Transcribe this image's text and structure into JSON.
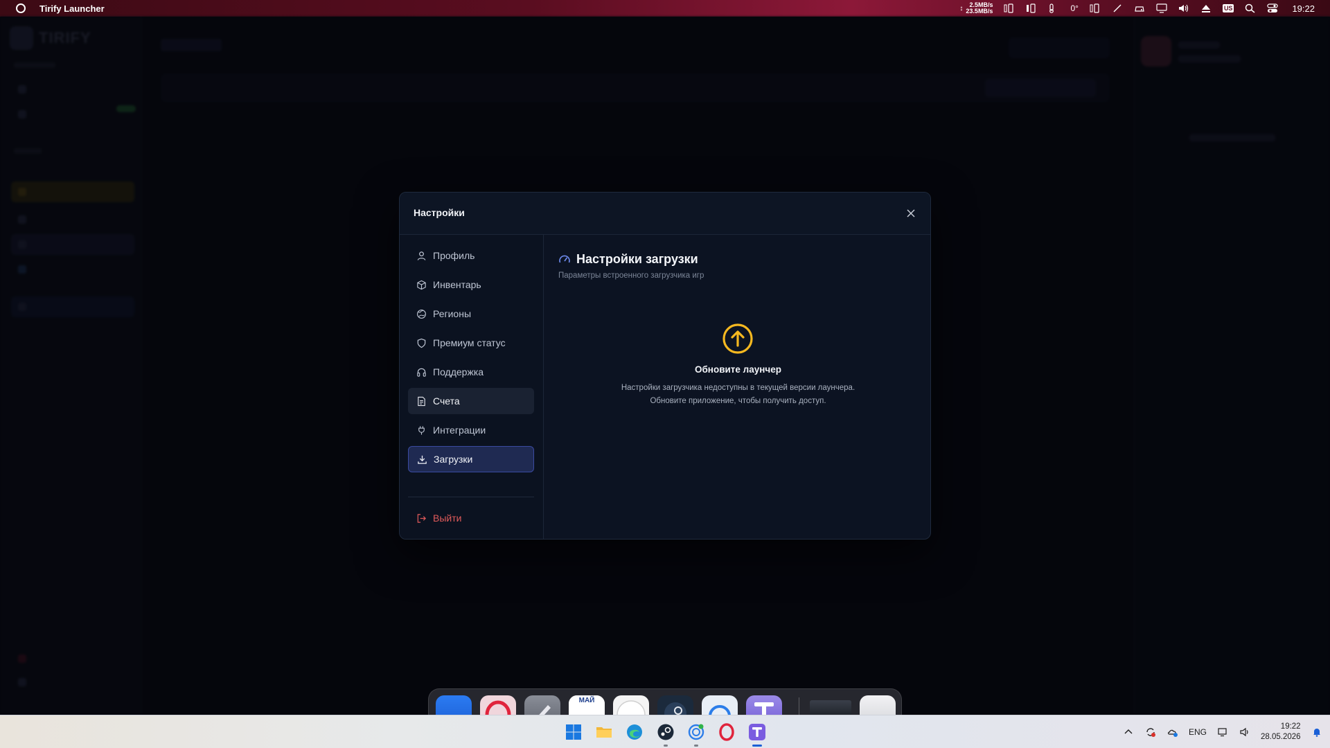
{
  "topbar": {
    "app_title": "Tirify Launcher",
    "net_up": "2.5MB/s",
    "net_down": "23.5MB/s",
    "temperature": "0°",
    "keyboard_layout": "US",
    "time": "19:22"
  },
  "modal": {
    "title": "Настройки",
    "nav": {
      "profile": "Профиль",
      "inventory": "Инвентарь",
      "regions": "Регионы",
      "premium": "Премиум статус",
      "support": "Поддержка",
      "billing": "Счета",
      "integrations": "Интеграции",
      "downloads": "Загрузки",
      "logout": "Выйти"
    },
    "content": {
      "title": "Настройки загрузки",
      "subtitle": "Параметры встроенного загрузчика игр",
      "update_title": "Обновите лаунчер",
      "update_line1": "Настройки загрузчика недоступны в текущей версии лаунчера.",
      "update_line2": "Обновите приложение, чтобы получить доступ."
    }
  },
  "dock": {
    "calendar_month": "МАЙ"
  },
  "taskbar": {
    "language": "ENG",
    "time": "19:22",
    "date": "28.05.2026"
  },
  "colors": {
    "accent": "#3a4aa0",
    "update_icon": "#f5b820",
    "logout": "#e05a5a",
    "modal_bg": "#0c1322"
  }
}
